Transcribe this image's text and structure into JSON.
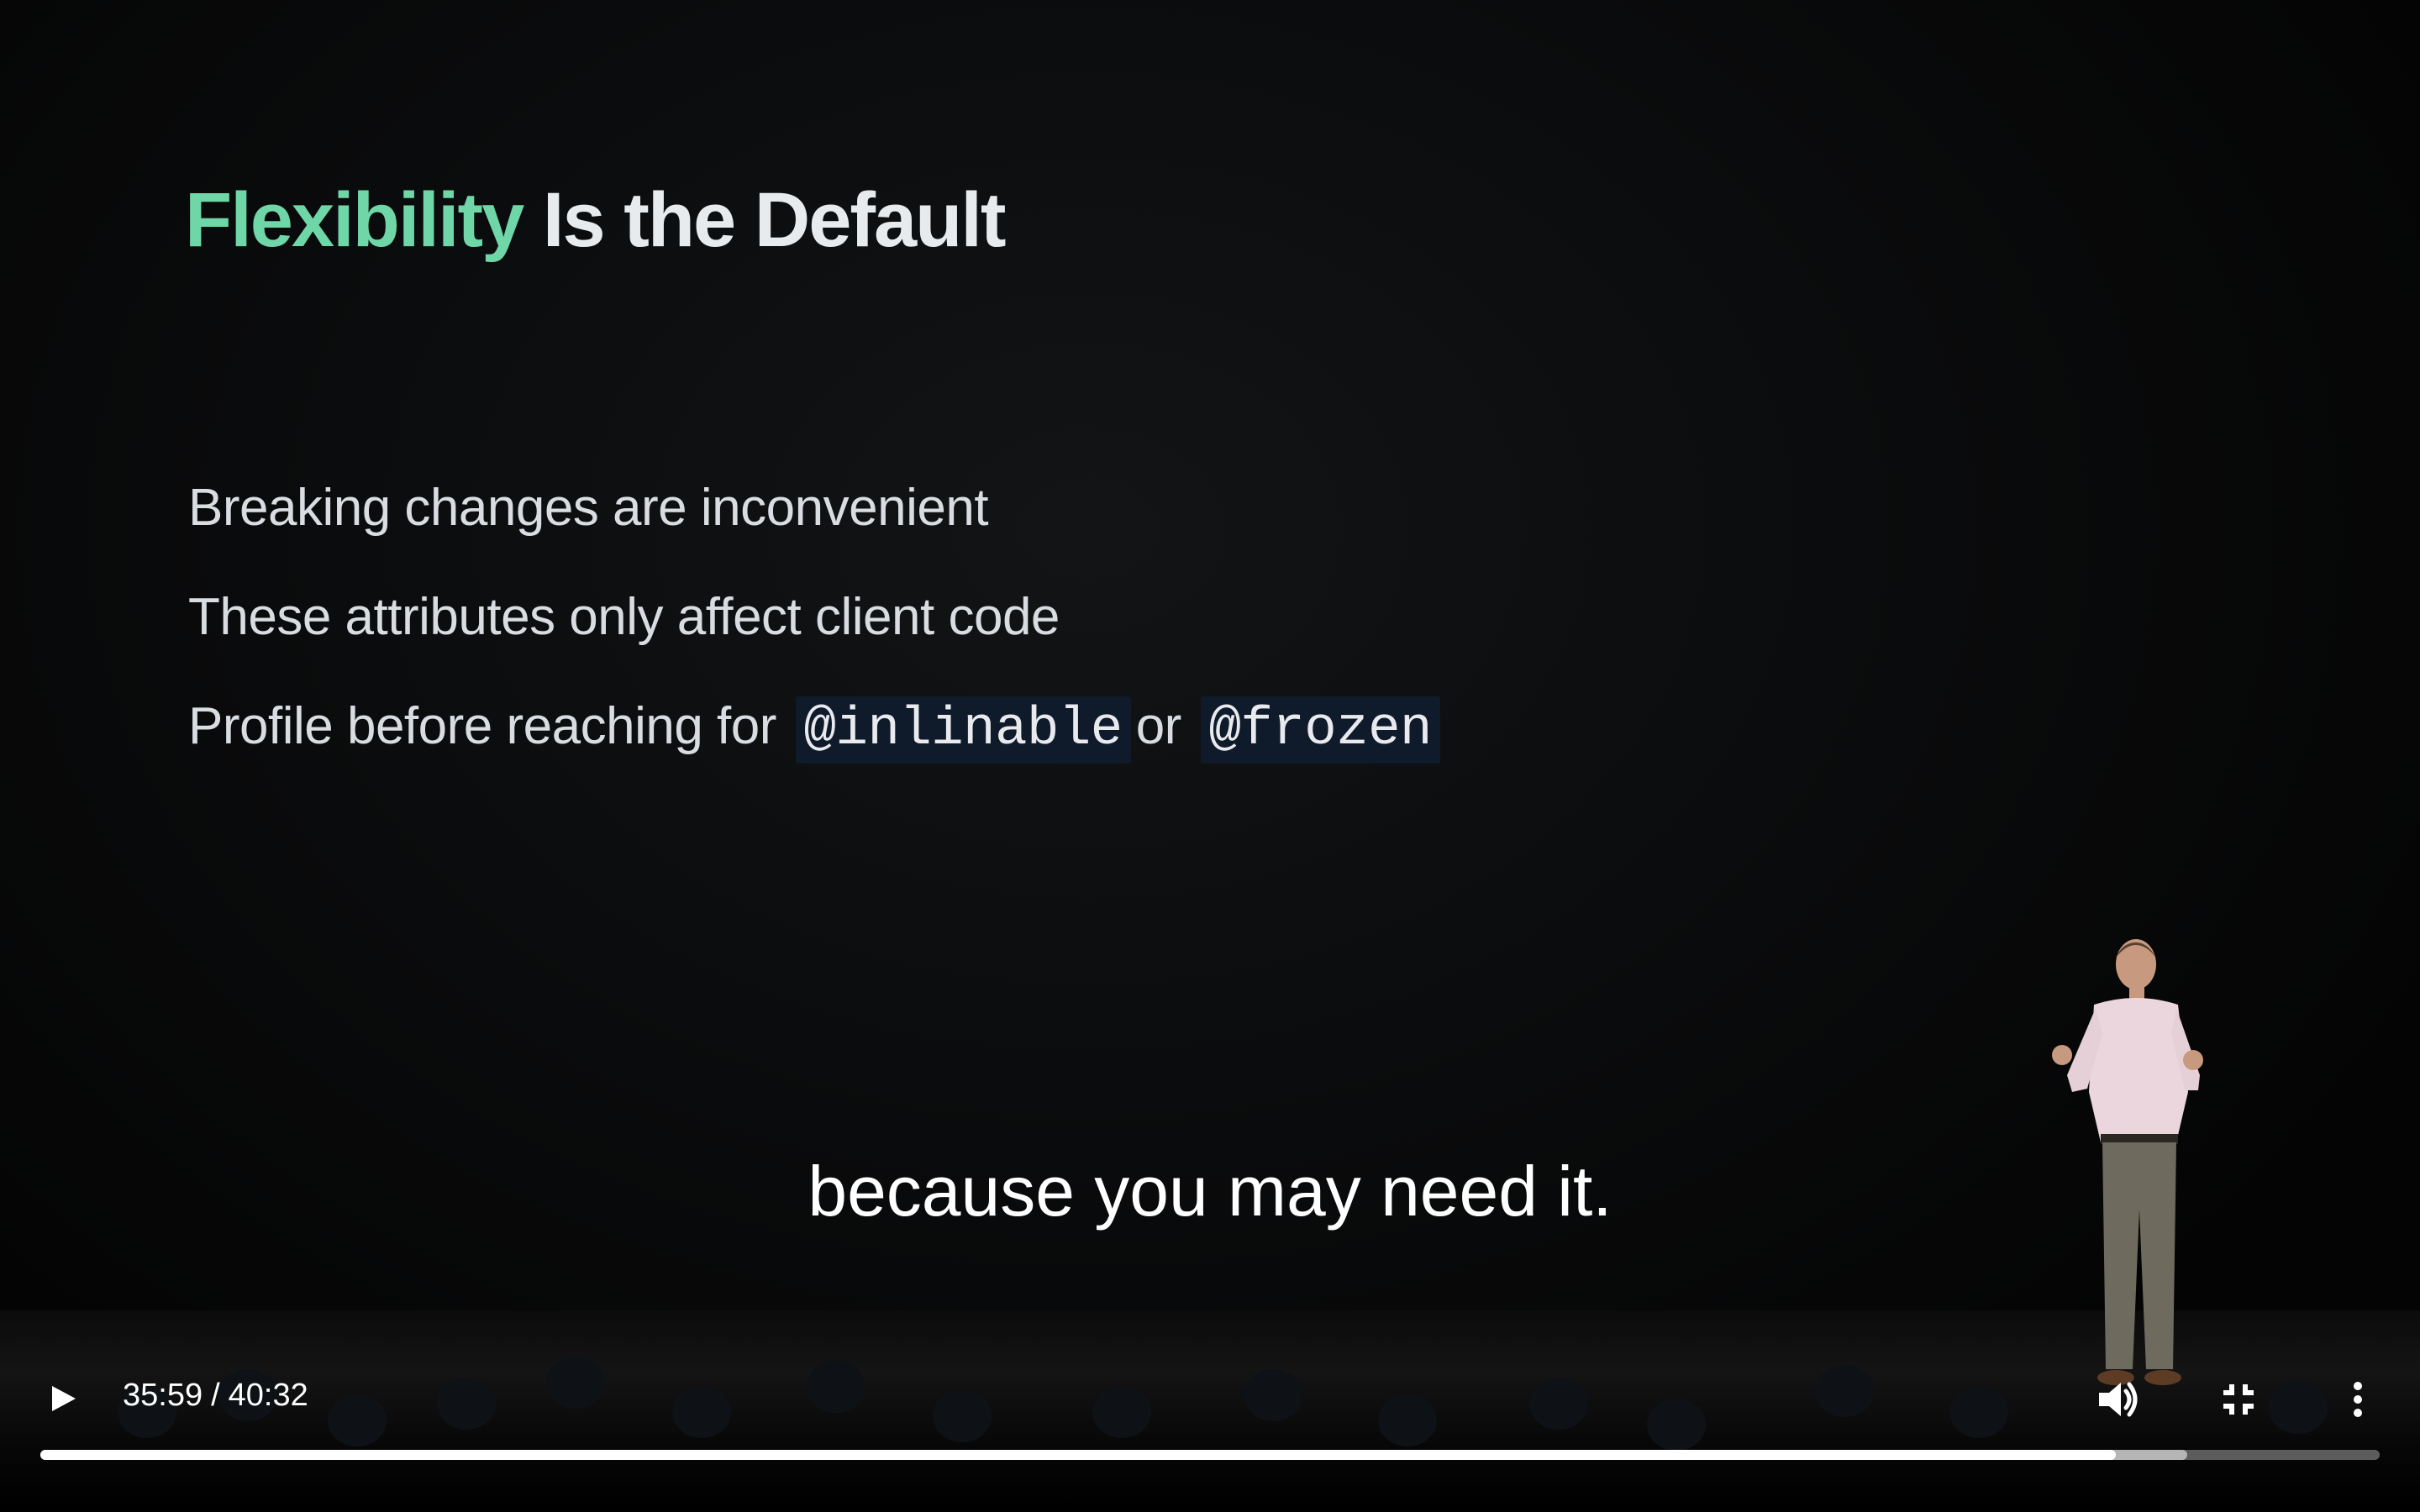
{
  "slide": {
    "title_accent": "Flexibility",
    "title_rest": "Is the Default",
    "bullets": [
      {
        "text": "Breaking changes are inconvenient"
      },
      {
        "text": "These attributes only affect client code"
      },
      {
        "text_before": "Profile before reaching for",
        "code1": "@inlinable",
        "text_mid": "or",
        "code2": "@frozen"
      }
    ],
    "colors": {
      "accent": "#6fd6a8",
      "title": "#e8ebee",
      "code_bg": "#0f1a2b"
    }
  },
  "captions": {
    "current": "because you may need it."
  },
  "player": {
    "current_time": "35:59",
    "separator": "/",
    "duration": "40:32",
    "played_fraction": 0.8872,
    "buffered_fraction": 0.9178,
    "icons": {
      "play": "play-icon",
      "volume": "volume-icon",
      "exit_fullscreen": "exit-fullscreen-icon",
      "more": "more-vertical-icon"
    }
  }
}
